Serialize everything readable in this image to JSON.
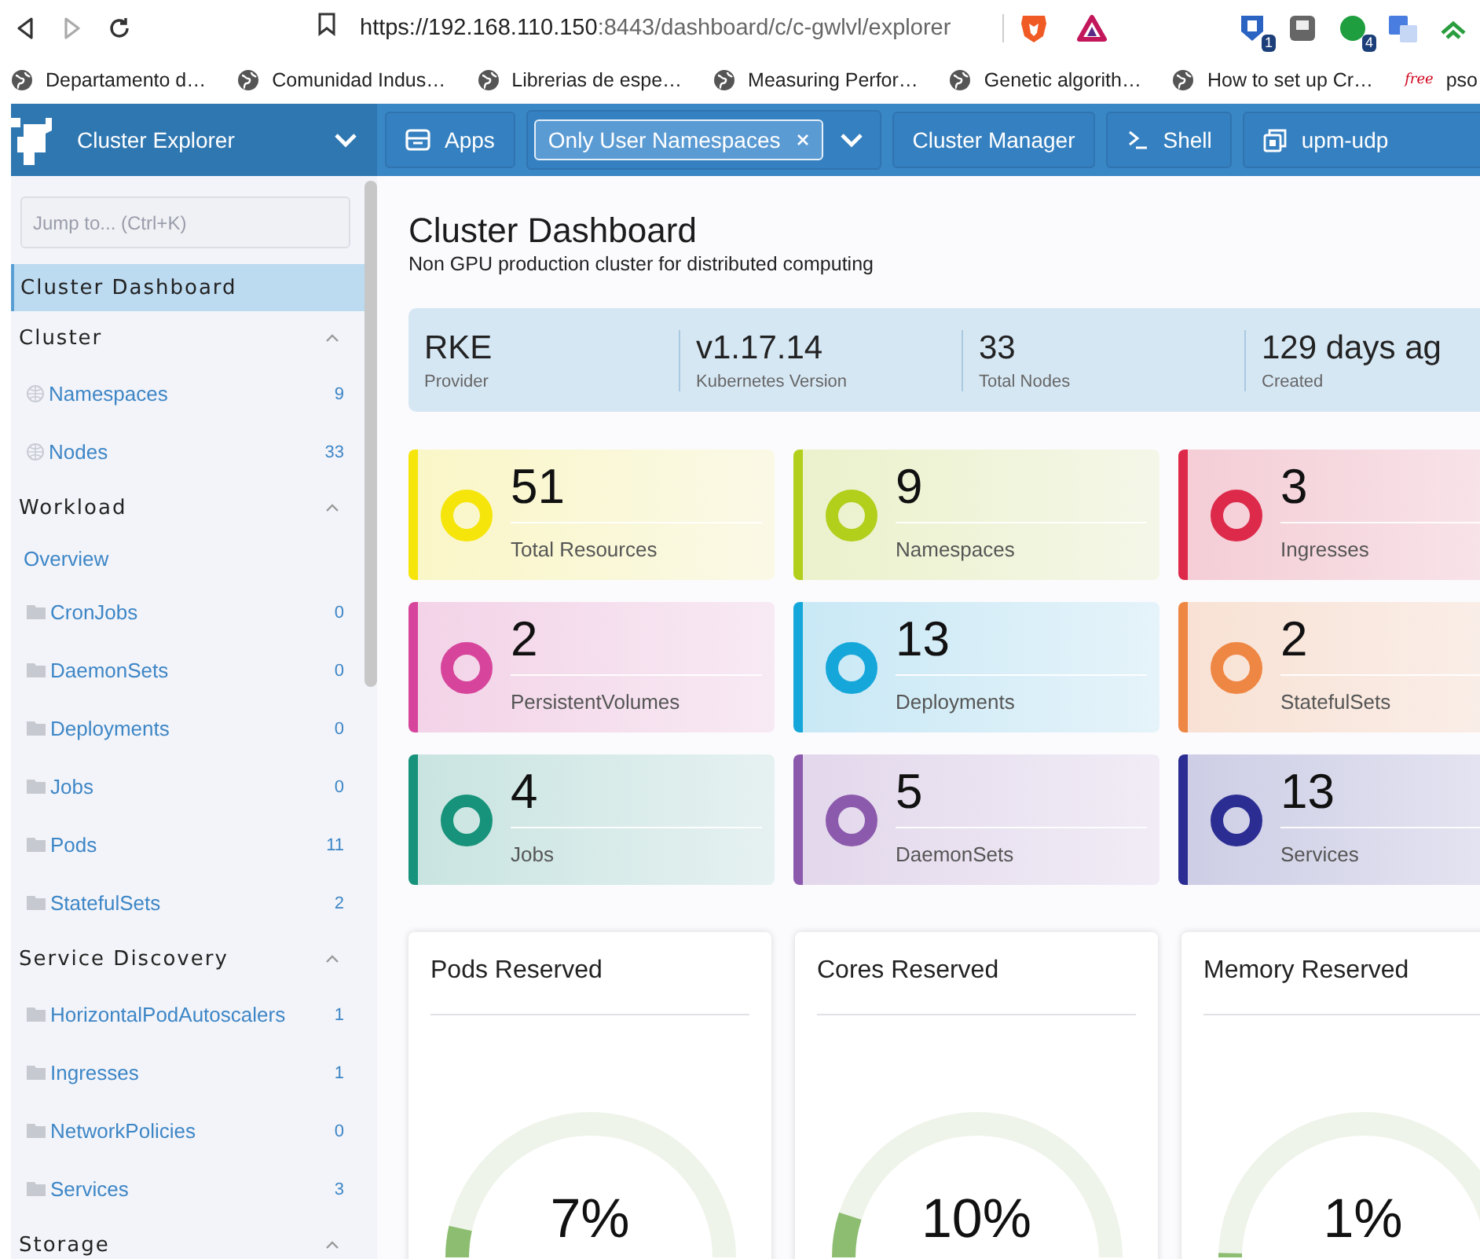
{
  "browser": {
    "navigation": [
      {
        "kind": "back",
        "disabled": false
      },
      {
        "kind": "forward",
        "disabled": true
      },
      {
        "kind": "reload",
        "disabled": false
      }
    ],
    "url_host": "https://192.168.110.150",
    "url_rest": ":8443/dashboard/c/c-gwlvl/explorer",
    "extensions": [
      {
        "kind": "shield",
        "badge": "1"
      },
      {
        "kind": "square"
      },
      {
        "kind": "dot",
        "badge": "4"
      },
      {
        "kind": "translate"
      },
      {
        "kind": "chevrons"
      }
    ],
    "bookmarks": [
      {
        "label": "Departamento d…",
        "kind": "globe"
      },
      {
        "label": "Comunidad Indus…",
        "kind": "globe"
      },
      {
        "label": "Librerias de espe…",
        "kind": "globe"
      },
      {
        "label": "Measuring Perfor…",
        "kind": "globe"
      },
      {
        "label": "Genetic algorith…",
        "kind": "globe"
      },
      {
        "label": "How to set up Cr…",
        "kind": "globe"
      },
      {
        "label": "pso",
        "kind": "favicon",
        "favicon_text": "free"
      }
    ]
  },
  "sidebar": {
    "title": "Cluster Explorer",
    "search": {
      "placeholder": "Jump to... (Ctrl+K)"
    },
    "top_items": [
      {
        "label": "Cluster Dashboard",
        "selected": true
      }
    ],
    "groups": [
      {
        "label": "Cluster",
        "expanded": true,
        "items": [
          {
            "label": "Namespaces",
            "count": "9",
            "kind": "globe",
            "selected": false
          },
          {
            "label": "Nodes",
            "count": "33",
            "kind": "globe",
            "selected": false
          }
        ]
      },
      {
        "label": "Workload",
        "expanded": true,
        "items": [
          {
            "label": "Overview",
            "kind": "link",
            "selected": false
          },
          {
            "label": "CronJobs",
            "count": "0",
            "kind": "folder",
            "selected": false
          },
          {
            "label": "DaemonSets",
            "count": "0",
            "kind": "folder",
            "selected": false
          },
          {
            "label": "Deployments",
            "count": "0",
            "kind": "folder",
            "selected": false
          },
          {
            "label": "Jobs",
            "count": "0",
            "kind": "folder",
            "selected": false
          },
          {
            "label": "Pods",
            "count": "11",
            "kind": "folder",
            "selected": false
          },
          {
            "label": "StatefulSets",
            "count": "2",
            "kind": "folder",
            "selected": false
          }
        ]
      },
      {
        "label": "Service Discovery",
        "expanded": true,
        "items": [
          {
            "label": "HorizontalPodAutoscalers",
            "count": "1",
            "kind": "folder",
            "selected": false
          },
          {
            "label": "Ingresses",
            "count": "1",
            "kind": "folder",
            "selected": false
          },
          {
            "label": "NetworkPolicies",
            "count": "0",
            "kind": "folder",
            "selected": false
          },
          {
            "label": "Services",
            "count": "3",
            "kind": "folder",
            "selected": false
          }
        ]
      },
      {
        "label": "Storage",
        "expanded": true
      }
    ]
  },
  "header": {
    "items": [
      {
        "kind": "apps",
        "label": "Apps"
      },
      {
        "kind": "filter",
        "label": "Only User Namespaces"
      },
      {
        "kind": "plain",
        "label": "Cluster Manager"
      },
      {
        "kind": "shell",
        "label": "Shell"
      },
      {
        "kind": "cluster",
        "label": "upm-udp"
      }
    ]
  },
  "dashboard": {
    "title": "Cluster Dashboard",
    "subtitle": "Non GPU production cluster for distributed computing",
    "facts": [
      {
        "value": "RKE",
        "label": "Provider"
      },
      {
        "value": "v1.17.14",
        "label": "Kubernetes Version"
      },
      {
        "value": "33",
        "label": "Total Nodes"
      },
      {
        "value": "129 days ag",
        "label": "Created"
      }
    ],
    "counts": [
      {
        "value": "51",
        "label": "Total Resources",
        "color": "#f5e50a"
      },
      {
        "value": "9",
        "label": "Namespaces",
        "color": "#b2cf1c"
      },
      {
        "value": "3",
        "label": "Ingresses",
        "color": "#dd2a4a"
      },
      {
        "value": "2",
        "label": "PersistentVolumes",
        "color": "#d6459b"
      },
      {
        "value": "13",
        "label": "Deployments",
        "color": "#16a7da"
      },
      {
        "value": "2",
        "label": "StatefulSets",
        "color": "#ef8744"
      },
      {
        "value": "4",
        "label": "Jobs",
        "color": "#17937b"
      },
      {
        "value": "5",
        "label": "DaemonSets",
        "color": "#8c5aad"
      },
      {
        "value": "13",
        "label": "Services",
        "color": "#2b2d92"
      }
    ],
    "gauges": [
      {
        "title": "Pods Reserved",
        "reading": "7%",
        "level": 0.07
      },
      {
        "title": "Cores Reserved",
        "reading": "10%",
        "level": 0.1
      },
      {
        "title": "Memory Reserved",
        "reading": "1%",
        "level": 0.01
      }
    ]
  }
}
